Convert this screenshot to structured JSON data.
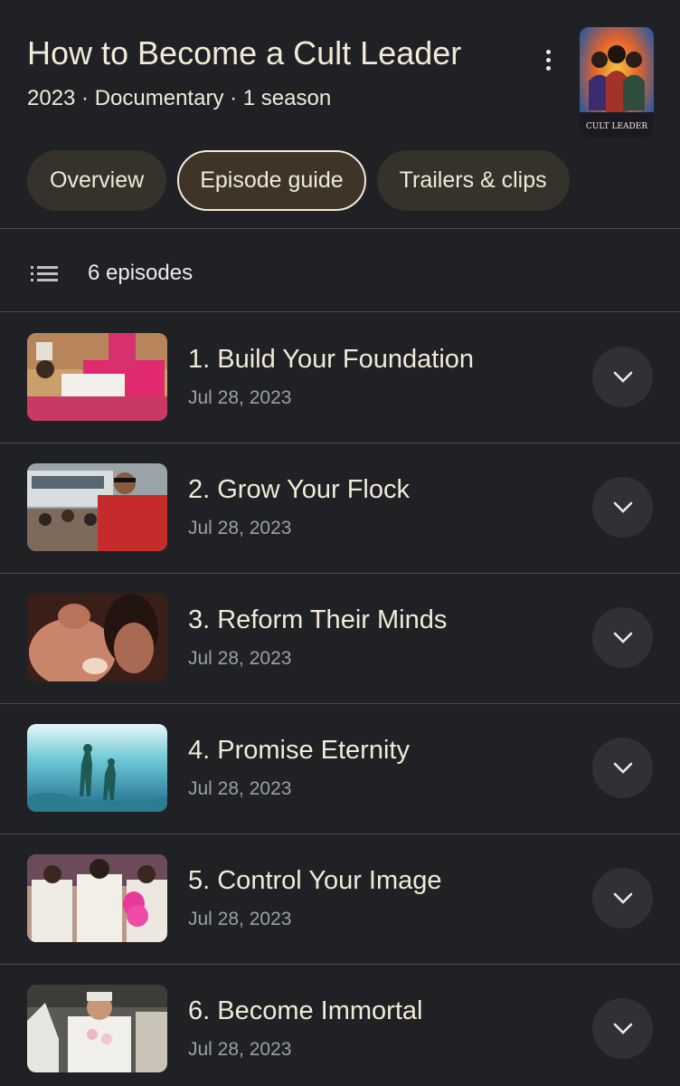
{
  "header": {
    "title": "How to Become a Cult Leader",
    "meta": "2023 · Documentary · 1 season",
    "more_icon": "more-vert-icon",
    "poster_text": "CULT LEADER"
  },
  "tabs": [
    {
      "label": "Overview",
      "active": false
    },
    {
      "label": "Episode guide",
      "active": true
    },
    {
      "label": "Trailers & clips",
      "active": false
    }
  ],
  "episode_count": "6 episodes",
  "episodes": [
    {
      "title": "1. Build Your Foundation",
      "date": "Jul 28, 2023"
    },
    {
      "title": "2. Grow Your Flock",
      "date": "Jul 28, 2023"
    },
    {
      "title": "3. Reform Their Minds",
      "date": "Jul 28, 2023"
    },
    {
      "title": "4. Promise Eternity",
      "date": "Jul 28, 2023"
    },
    {
      "title": "5. Control Your Image",
      "date": "Jul 28, 2023"
    },
    {
      "title": "6. Become Immortal",
      "date": "Jul 28, 2023"
    }
  ],
  "colors": {
    "background": "#202124",
    "chip": "#35322c",
    "chip_active_border": "#f1ead8",
    "title_text": "#f1ead8",
    "date_text": "#9aa0a6"
  }
}
